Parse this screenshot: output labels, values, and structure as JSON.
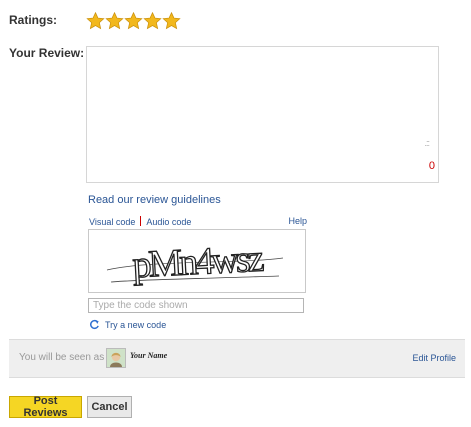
{
  "ratings": {
    "label": "Ratings:",
    "value": 5,
    "max": 5,
    "star_color": "#f2b81d"
  },
  "review": {
    "label": "Your Review:",
    "value": "",
    "char_count": "0"
  },
  "guidelines_link": "Read our review guidelines",
  "captcha": {
    "visual_tab": "Visual code",
    "audio_tab": "Audio code",
    "help": "Help",
    "code_text": "pMn4wsz",
    "input_placeholder": "Type the code shown",
    "new_code": "Try a new code"
  },
  "identity": {
    "seen_as": "You will be seen as :",
    "name": "Your Name",
    "edit_profile": "Edit Profile"
  },
  "buttons": {
    "post": "Post Reviews",
    "cancel": "Cancel"
  },
  "colors": {
    "link": "#2a5595",
    "counter": "#cc0000",
    "post_button": "#f5d624"
  }
}
